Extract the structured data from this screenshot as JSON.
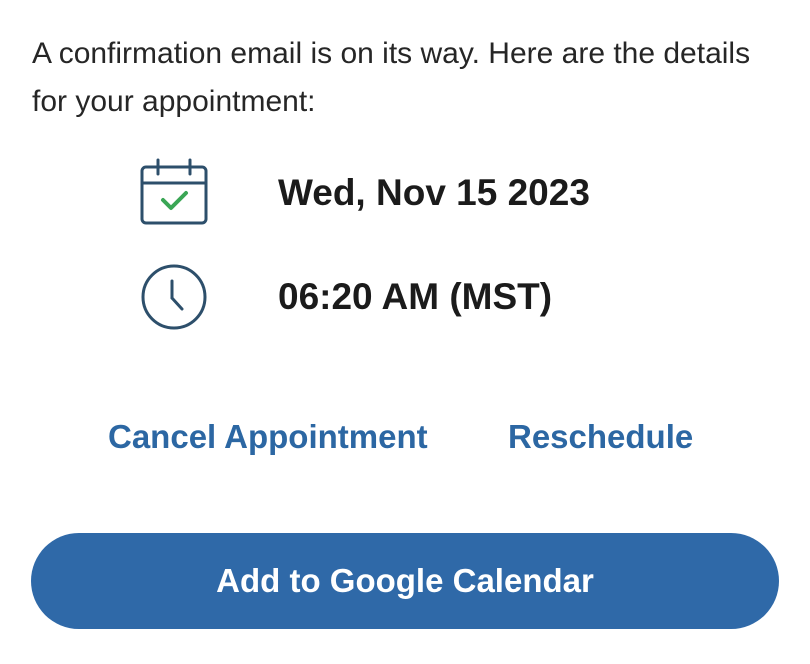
{
  "intro_text": "A confirmation email is on its way. Here are the details for your appointment:",
  "appointment": {
    "date": "Wed, Nov 15 2023",
    "time": "06:20 AM (MST)"
  },
  "actions": {
    "cancel_label": "Cancel Appointment",
    "reschedule_label": "Reschedule",
    "add_calendar_label": "Add to Google Calendar"
  },
  "icons": {
    "date": "calendar-check-icon",
    "time": "clock-icon"
  },
  "colors": {
    "accent": "#2f69a8",
    "link": "#2c67a3",
    "icon_stroke": "#2d4f6b",
    "check": "#3aa655",
    "text": "#1b1b1b"
  }
}
